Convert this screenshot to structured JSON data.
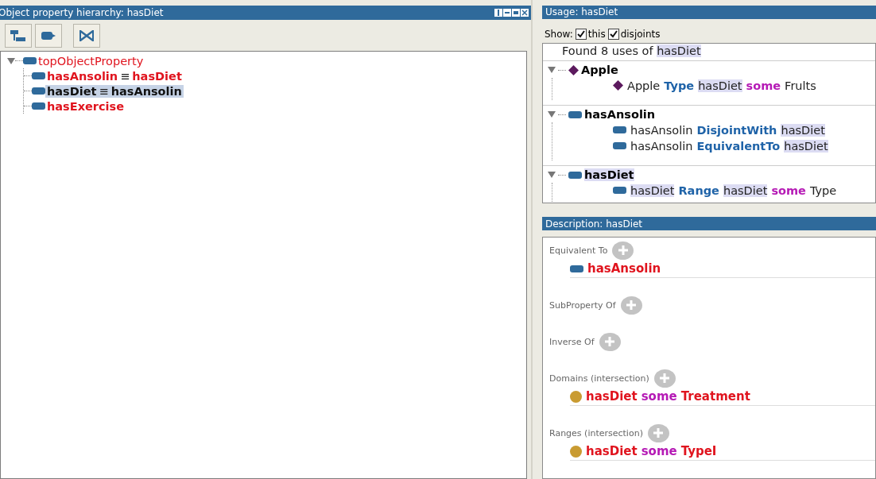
{
  "hierarchy": {
    "title": "Object property hierarchy: hasDiet",
    "tree": [
      {
        "label": "topObjectProperty",
        "expanded": true,
        "bold": false,
        "selected": false,
        "children": [
          {
            "label": "hasAnsolin",
            "sep": "≡",
            "equivalent": "hasDiet",
            "bold": true,
            "selected": false
          },
          {
            "label": "hasDiet",
            "sep": "≡",
            "equivalent": "hasAnsolin",
            "bold": true,
            "selected": true
          },
          {
            "label": "hasExercise",
            "bold": true,
            "selected": false
          }
        ]
      }
    ]
  },
  "usage": {
    "title": "Usage: hasDiet",
    "show_label": "Show:",
    "options": [
      {
        "label": "this",
        "checked": true
      },
      {
        "label": "disjoints",
        "checked": true
      }
    ],
    "found": [
      {
        "text": "Found 8 uses of ",
        "kind": "plain"
      },
      {
        "text": "hasDiet",
        "kind": "highlight"
      }
    ],
    "groups": [
      {
        "kind": "individual",
        "name": "Apple",
        "highlight": false,
        "expanded": true,
        "rows": [
          [
            {
              "kind": "individual"
            },
            {
              "text": "Apple",
              "kind": "plain"
            },
            {
              "text": "Type",
              "kind": "keyword"
            },
            {
              "text": "hasDiet",
              "kind": "highlight"
            },
            {
              "text": "some",
              "kind": "some"
            },
            {
              "text": "Frults",
              "kind": "plain"
            }
          ]
        ]
      },
      {
        "kind": "property",
        "name": "hasAnsolin",
        "highlight": false,
        "expanded": true,
        "rows": [
          [
            {
              "kind": "property"
            },
            {
              "text": "hasAnsolin",
              "kind": "plain"
            },
            {
              "text": "DisjointWith",
              "kind": "keyword"
            },
            {
              "text": "hasDiet",
              "kind": "highlight"
            }
          ],
          [
            {
              "kind": "property"
            },
            {
              "text": "hasAnsolin",
              "kind": "plain"
            },
            {
              "text": "EquivalentTo",
              "kind": "keyword"
            },
            {
              "text": "hasDiet",
              "kind": "highlight"
            }
          ]
        ]
      },
      {
        "kind": "property",
        "name": "hasDiet",
        "highlight": true,
        "expanded": true,
        "rows": [
          [
            {
              "kind": "property"
            },
            {
              "text": "hasDiet",
              "kind": "highlight"
            },
            {
              "text": "Range",
              "kind": "keyword"
            },
            {
              "text": "hasDiet",
              "kind": "highlight"
            },
            {
              "text": "some",
              "kind": "some"
            },
            {
              "text": "Type",
              "kind": "plain"
            }
          ]
        ]
      }
    ]
  },
  "description": {
    "title": "Description: hasDiet",
    "sections": [
      {
        "label": "Equivalent To",
        "items": [
          {
            "kind": "property",
            "tokens": [
              {
                "text": "hasAnsolin",
                "kind": "entity"
              }
            ]
          }
        ]
      },
      {
        "label": "SubProperty Of"
      },
      {
        "label": "Inverse Of"
      },
      {
        "label": "Domains (intersection)",
        "items": [
          {
            "kind": "class",
            "tokens": [
              {
                "text": "hasDiet",
                "kind": "entity"
              },
              {
                "text": "some",
                "kind": "some"
              },
              {
                "text": "Treatment",
                "kind": "entity"
              }
            ]
          }
        ]
      },
      {
        "label": "Ranges (intersection)",
        "items": [
          {
            "kind": "class",
            "tokens": [
              {
                "text": "hasDiet",
                "kind": "entity"
              },
              {
                "text": "some",
                "kind": "some"
              },
              {
                "text": "TypeI",
                "kind": "entity"
              }
            ]
          }
        ]
      }
    ]
  }
}
